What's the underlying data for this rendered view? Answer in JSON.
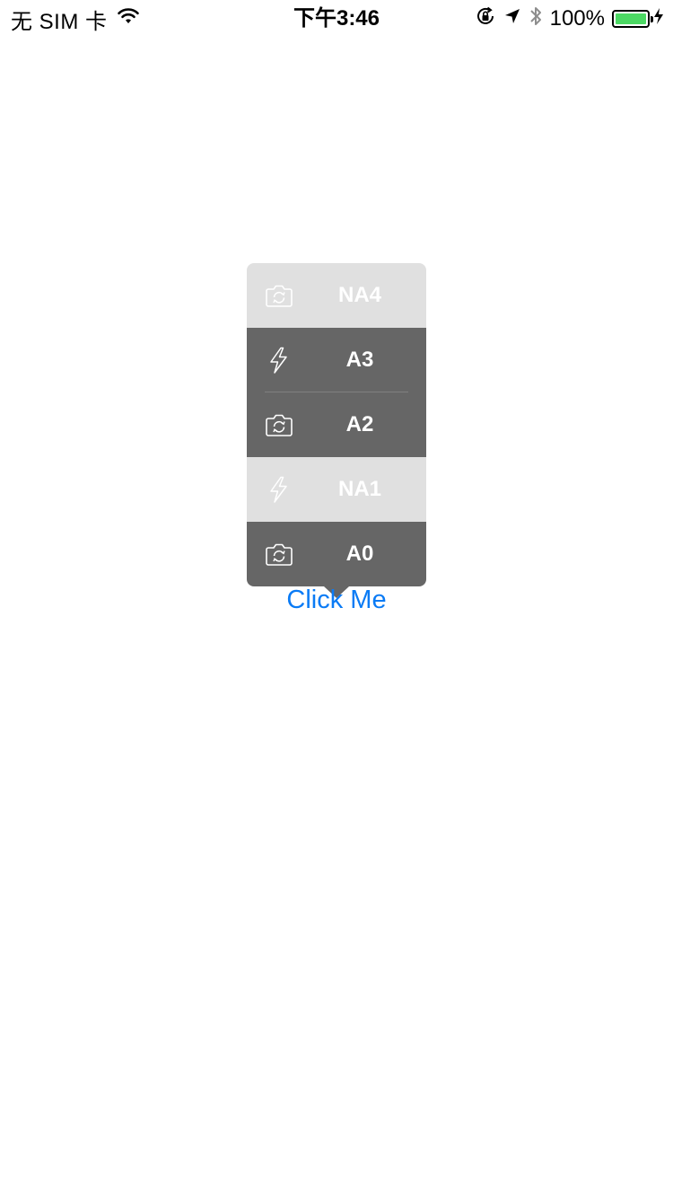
{
  "status_bar": {
    "carrier": "无 SIM 卡",
    "time": "下午3:46",
    "battery_percent": "100%",
    "battery_level": 1.0,
    "icons": [
      "wifi-icon",
      "orientation-lock-icon",
      "location-icon",
      "bluetooth-icon",
      "battery-icon",
      "charging-icon"
    ]
  },
  "menu": {
    "items": [
      {
        "label": "NA4",
        "icon": "camera-rotate-icon",
        "enabled": false
      },
      {
        "label": "A3",
        "icon": "flash-icon",
        "enabled": true
      },
      {
        "label": "A2",
        "icon": "camera-rotate-icon",
        "enabled": true
      },
      {
        "label": "NA1",
        "icon": "flash-icon",
        "enabled": false
      },
      {
        "label": "A0",
        "icon": "camera-rotate-icon",
        "enabled": true
      }
    ]
  },
  "button": {
    "label": "Click Me"
  },
  "colors": {
    "accent": "#0a7bf5",
    "menu_enabled_bg": "#666666",
    "menu_disabled_bg": "#e0e0e0",
    "battery_fill": "#4cd964"
  }
}
